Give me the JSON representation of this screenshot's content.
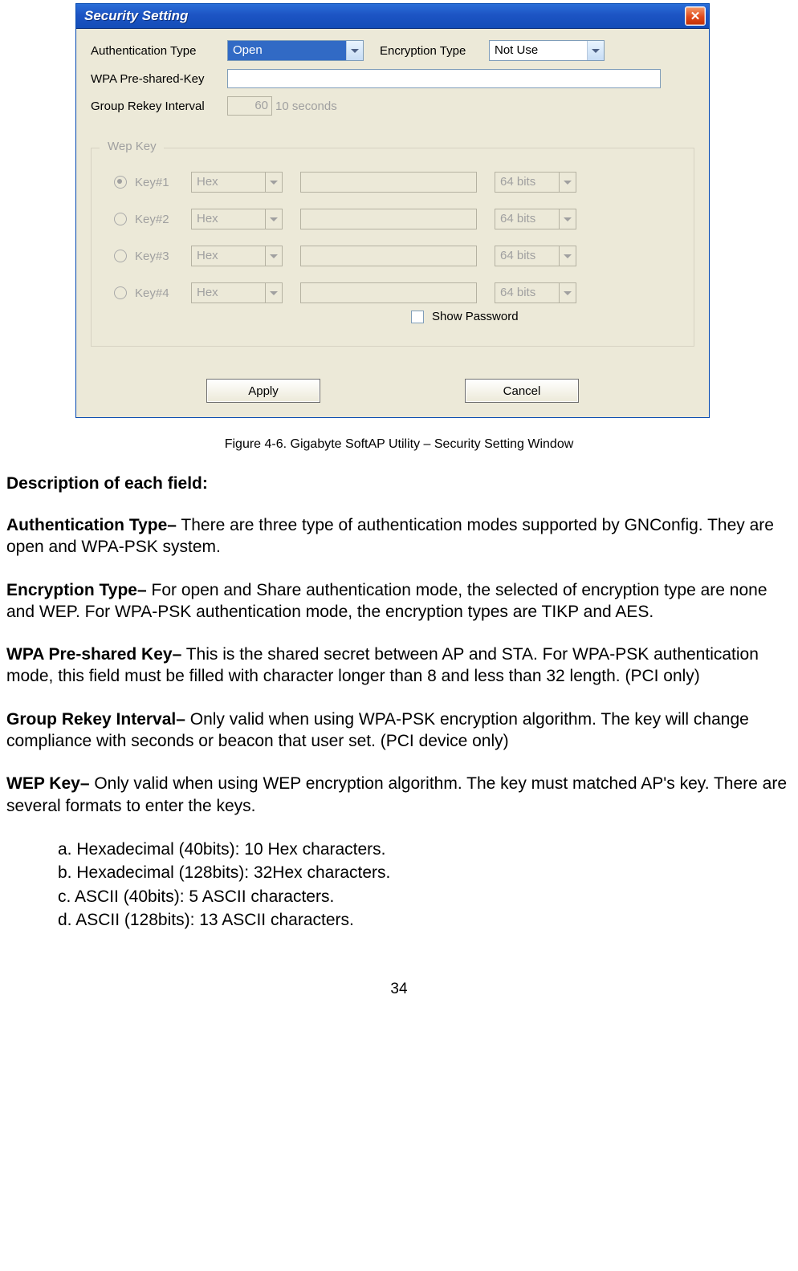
{
  "dialog": {
    "title": "Security Setting",
    "close_icon": "✕",
    "labels": {
      "auth": "Authentication Type",
      "enc": "Encryption Type",
      "wpa": "WPA Pre-shared-Key",
      "gri": "Group Rekey Interval"
    },
    "auth_value": "Open",
    "enc_value": "Not Use",
    "gri_value": "60",
    "gri_unit": "10 seconds",
    "wep_legend": "Wep Key",
    "wep_rows": [
      {
        "label": "Key#1",
        "checked": true,
        "format": "Hex",
        "bits": "64 bits"
      },
      {
        "label": "Key#2",
        "checked": false,
        "format": "Hex",
        "bits": "64 bits"
      },
      {
        "label": "Key#3",
        "checked": false,
        "format": "Hex",
        "bits": "64 bits"
      },
      {
        "label": "Key#4",
        "checked": false,
        "format": "Hex",
        "bits": "64 bits"
      }
    ],
    "show_password": "Show Password",
    "apply": "Apply",
    "cancel": "Cancel"
  },
  "caption": "Figure 4-6.    Gigabyte SoftAP Utility – Security Setting Window",
  "desc_heading": "Description of each field:",
  "paras": {
    "auth_t": "Authentication Type–",
    "auth_b": " There are three type of authentication modes supported by GNConfig. They are open and WPA-PSK system.",
    "enc_t": "Encryption Type–",
    "enc_b": " For open and Share authentication mode, the selected of encryption type are none and WEP. For WPA-PSK authentication mode, the encryption types are TIKP and AES.",
    "wpa_t": "WPA Pre-shared Key–",
    "wpa_b": " This is the shared secret between AP and STA. For WPA-PSK authentication mode, this field must be filled with character longer than 8 and less than 32 length. (PCI only)",
    "gri_t": "Group Rekey Interval–",
    "gri_b": " Only valid when using WPA-PSK encryption algorithm. The key will change compliance with seconds or beacon that user set. (PCI device only)",
    "wep_t": "WEP Key–",
    "wep_b": " Only valid when using WEP encryption algorithm. The key must matched AP's key. There are several formats to enter the keys."
  },
  "list": {
    "a": "a. Hexadecimal (40bits): 10 Hex characters.",
    "b": "b. Hexadecimal (128bits): 32Hex characters.",
    "c": "c. ASCII (40bits): 5 ASCII characters.",
    "d": "d. ASCII (128bits): 13 ASCII characters."
  },
  "page_number": "34"
}
